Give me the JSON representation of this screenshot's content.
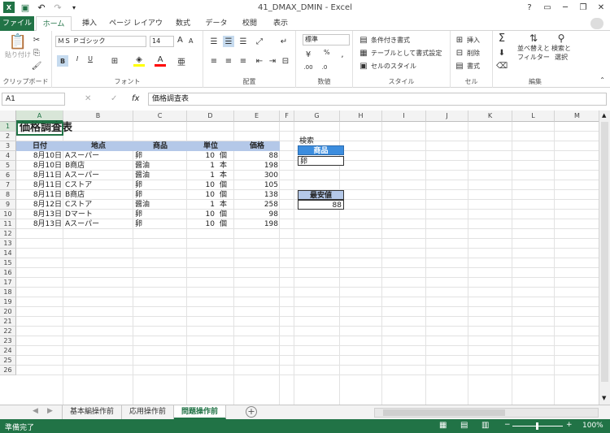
{
  "titlebar": {
    "title": "41_DMAX_DMIN - Excel",
    "save_icon": "save-icon",
    "undo_icon": "undo-icon",
    "redo_icon": "redo-icon",
    "help": "?"
  },
  "tabs": [
    "ファイル",
    "ホーム",
    "挿入",
    "ページ レイアウト",
    "数式",
    "データ",
    "校閲",
    "表示"
  ],
  "ribbon": {
    "clipboard": {
      "label": "クリップボード",
      "paste": "貼り付け"
    },
    "font": {
      "label": "フォント",
      "name": "ＭＳ Ｐゴシック",
      "size": "14",
      "bold": "B",
      "italic": "I",
      "underline": "U",
      "grow": "A",
      "shrink": "A"
    },
    "alignment": {
      "label": "配置"
    },
    "number": {
      "label": "数値",
      "format": "標準",
      "percent": "%"
    },
    "styles": {
      "label": "スタイル",
      "conditional": "条件付き書式",
      "table": "テーブルとして書式設定",
      "cell": "セルのスタイル"
    },
    "cells": {
      "label": "セル",
      "insert": "挿入",
      "delete": "削除",
      "format": "書式"
    },
    "editing": {
      "label": "編集",
      "sort": "並べ替えと",
      "filter": "フィルター",
      "find": "検索と",
      "select": "選択"
    }
  },
  "formula_bar": {
    "name_box": "A1",
    "fx": "fx",
    "content": "価格調査表"
  },
  "columns": [
    "A",
    "B",
    "C",
    "D",
    "E",
    "F",
    "G",
    "H",
    "I",
    "J",
    "K",
    "L",
    "M"
  ],
  "rows": [
    "1",
    "2",
    "3",
    "4",
    "5",
    "6",
    "7",
    "8",
    "9",
    "10",
    "11",
    "12",
    "13",
    "14",
    "15",
    "16",
    "17",
    "18",
    "19",
    "20",
    "21",
    "22",
    "23",
    "24",
    "25",
    "26"
  ],
  "sheet": {
    "title": "価格調査表",
    "headers": [
      "日付",
      "地点",
      "商品",
      "単位",
      "価格"
    ],
    "data": [
      [
        "8月10日",
        "Aスーパー",
        "卵",
        "10",
        "個",
        "88"
      ],
      [
        "8月10日",
        "B商店",
        "醤油",
        "1",
        "本",
        "198"
      ],
      [
        "8月11日",
        "Aスーパー",
        "醤油",
        "1",
        "本",
        "300"
      ],
      [
        "8月11日",
        "Cストア",
        "卵",
        "10",
        "個",
        "105"
      ],
      [
        "8月11日",
        "B商店",
        "卵",
        "10",
        "個",
        "138"
      ],
      [
        "8月12日",
        "Cストア",
        "醤油",
        "1",
        "本",
        "258"
      ],
      [
        "8月13日",
        "Dマート",
        "卵",
        "10",
        "個",
        "98"
      ],
      [
        "8月13日",
        "Aスーパー",
        "卵",
        "10",
        "個",
        "198"
      ]
    ],
    "search_label": "検索",
    "criteria_header": "商品",
    "criteria_value": "卵",
    "min_header": "最安値",
    "min_value": "88"
  },
  "sheet_tabs": [
    "基本編操作前",
    "応用操作前",
    "問題操作前"
  ],
  "status": {
    "ready": "準備完了",
    "zoom": "100%",
    "minus": "−",
    "plus": "+"
  }
}
